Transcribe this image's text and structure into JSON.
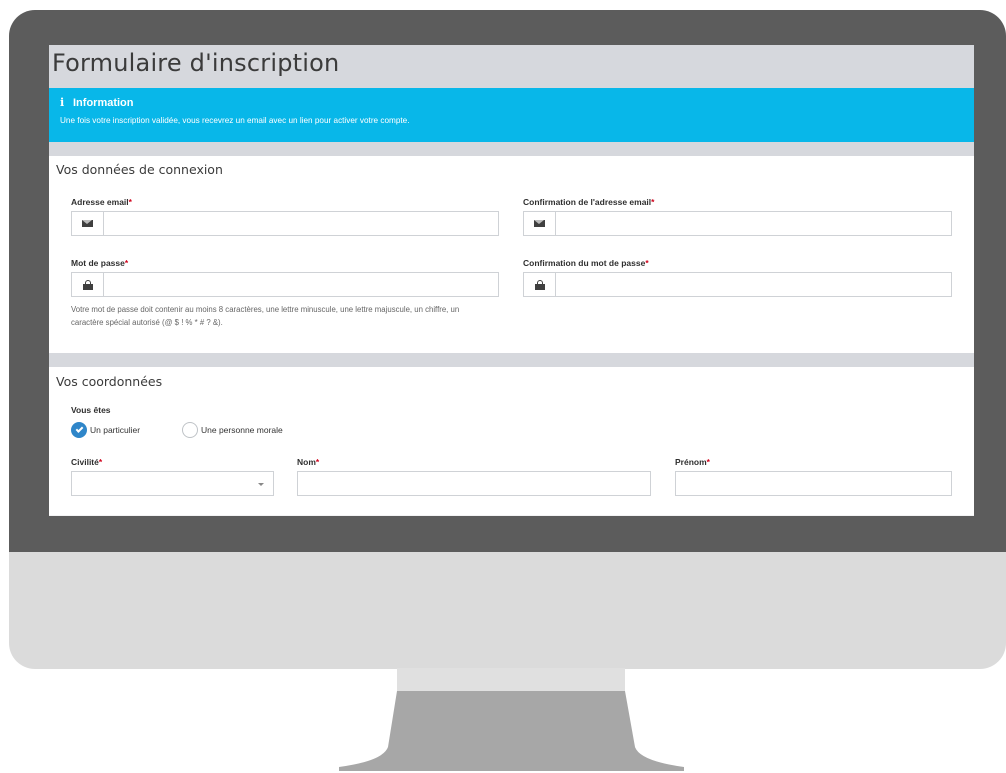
{
  "page": {
    "title": "Formulaire d'inscription"
  },
  "info": {
    "title": "Information",
    "text": "Une fois votre inscription validée, vous recevrez un email avec un lien pour activer votre compte."
  },
  "login_section": {
    "title": "Vos données de connexion",
    "email_label": "Adresse email",
    "email_confirm_label": "Confirmation de l'adresse email",
    "password_label": "Mot de passe",
    "password_confirm_label": "Confirmation du mot de passe",
    "required_mark": "*",
    "email_value": "",
    "email_confirm_value": "",
    "password_value": "",
    "password_confirm_value": "",
    "password_help": "Votre mot de passe doit contenir au moins 8 caractères, une lettre minuscule, une lettre majuscule, un chiffre, un caractère spécial autorisé (@ $ ! % * # ? &)."
  },
  "contact_section": {
    "title": "Vos coordonnées",
    "you_are_label": "Vous êtes",
    "options": [
      {
        "label": "Un particulier",
        "selected": true
      },
      {
        "label": "Une personne morale",
        "selected": false
      }
    ],
    "civility_label": "Civilité",
    "civility_value": "",
    "last_name_label": "Nom",
    "first_name_label": "Prénom",
    "last_name_value": "",
    "first_name_value": ""
  },
  "colors": {
    "info_bg": "#08b7e9",
    "radio_selected": "#2f86c9",
    "required": "#d0021b",
    "bezel": "#5c5c5c"
  },
  "icons": {
    "info": "info-icon",
    "email": "envelope-icon",
    "password": "lock-icon",
    "radio_check": "check-icon",
    "select": "caret-down-icon"
  }
}
